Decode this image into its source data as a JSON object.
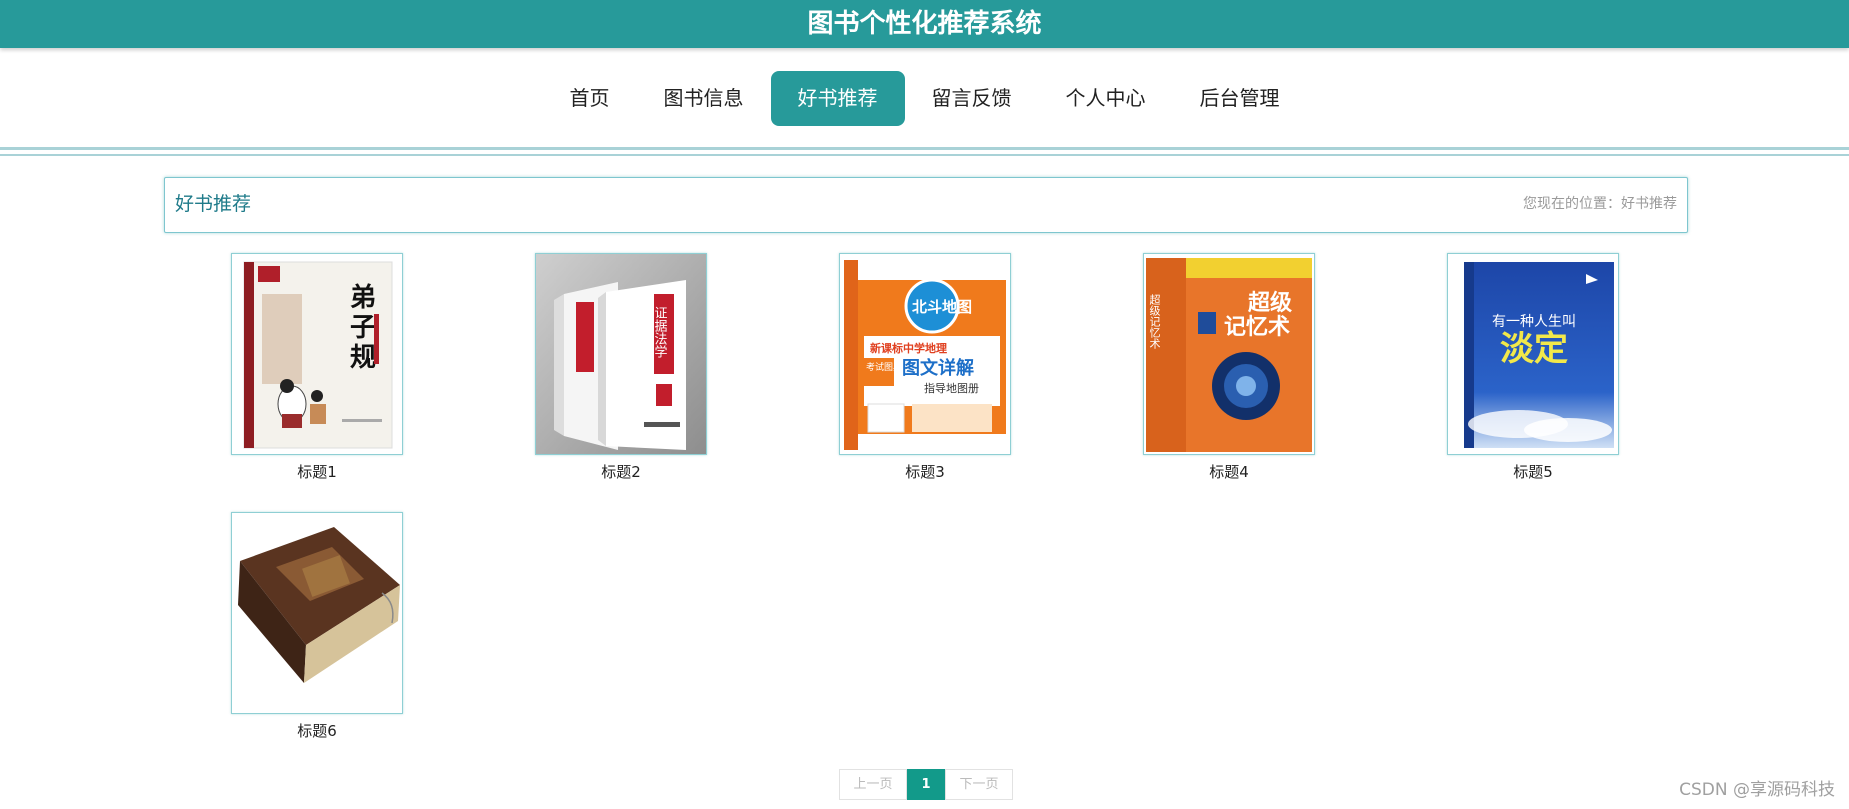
{
  "header": {
    "title": "图书个性化推荐系统"
  },
  "nav": {
    "items": [
      {
        "label": "首页"
      },
      {
        "label": "图书信息"
      },
      {
        "label": "好书推荐"
      },
      {
        "label": "留言反馈"
      },
      {
        "label": "个人中心"
      },
      {
        "label": "后台管理"
      }
    ],
    "active": "好书推荐"
  },
  "section": {
    "title": "好书推荐",
    "breadcrumb": "您现在的位置：好书推荐"
  },
  "books": [
    {
      "caption": "标题1",
      "cover_text": [
        "弟",
        "子",
        "规"
      ]
    },
    {
      "caption": "标题2",
      "cover_text": "证据法学"
    },
    {
      "caption": "标题3",
      "cover_text": [
        "北斗地图",
        "新课标中学地理",
        "图文详解",
        "指导地图册",
        "考试图典"
      ]
    },
    {
      "caption": "标题4",
      "cover_text": [
        "超级",
        "记忆术",
        "超级记忆术"
      ]
    },
    {
      "caption": "标题5",
      "cover_text": [
        "有一种人生叫",
        "淡定"
      ]
    },
    {
      "caption": "标题6"
    }
  ],
  "pagination": {
    "prev": "上一页",
    "current": "1",
    "next": "下一页"
  },
  "watermark": "CSDN @享源码科技",
  "colors": {
    "accent": "#279a9a",
    "pager_active": "#129a8a"
  }
}
